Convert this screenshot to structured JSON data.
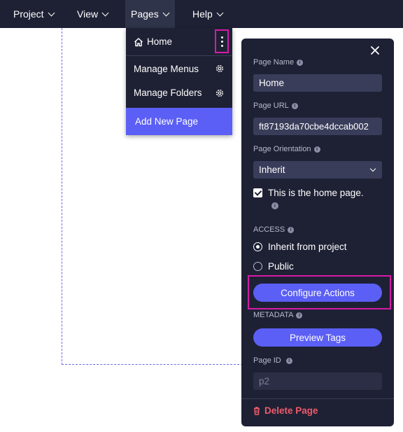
{
  "menubar": {
    "items": [
      {
        "label": "Project"
      },
      {
        "label": "View"
      },
      {
        "label": "Pages"
      },
      {
        "label": "Help"
      }
    ]
  },
  "pages_dropdown": {
    "home_label": "Home",
    "manage_menus_label": "Manage Menus",
    "manage_folders_label": "Manage Folders",
    "add_new_page_label": "Add New Page"
  },
  "page_settings": {
    "page_name_label": "Page Name",
    "page_name_value": "Home",
    "page_url_label": "Page URL",
    "page_url_value": "ft87193da70cbe4dccab002",
    "orientation_label": "Page Orientation",
    "orientation_value": "Inherit",
    "home_checkbox_label": "This is the home page.",
    "home_checkbox_checked": true,
    "access_label": "ACCESS",
    "access_options": [
      {
        "label": "Inherit from project",
        "selected": true
      },
      {
        "label": "Public",
        "selected": false
      }
    ],
    "configure_actions_label": "Configure Actions",
    "metadata_label": "METADATA",
    "preview_tags_label": "Preview Tags",
    "page_id_label": "Page ID",
    "page_id_value": "p2",
    "delete_label": "Delete Page"
  },
  "colors": {
    "topbar_bg": "#1e2134",
    "accent": "#5b5ff5",
    "highlight": "#d61aa8",
    "danger": "#f05a6a"
  },
  "icons": [
    "chevron-down-icon",
    "home-icon",
    "kebab-menu-icon",
    "gear-icon",
    "close-icon",
    "info-icon",
    "check-icon",
    "trash-icon"
  ]
}
